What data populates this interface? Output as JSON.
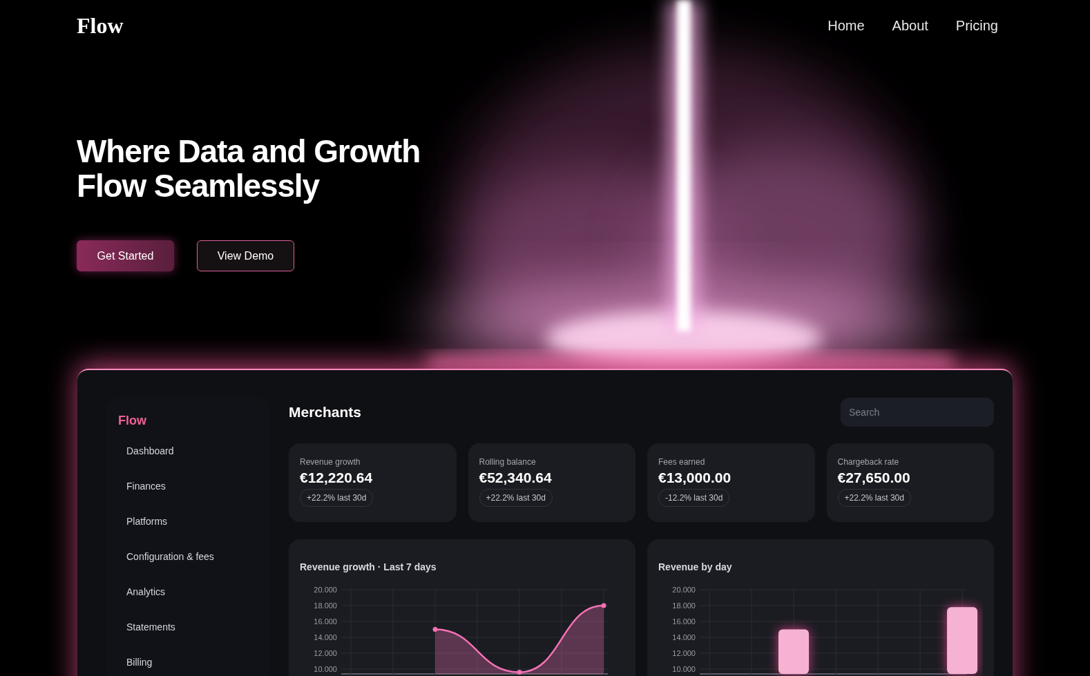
{
  "brand": "Flow",
  "nav": [
    {
      "label": "Home"
    },
    {
      "label": "About"
    },
    {
      "label": "Pricing"
    }
  ],
  "hero": {
    "title": "Where Data and Growth Flow Seamlessly",
    "buttons": [
      {
        "label": "Get Started",
        "kind": "primary"
      },
      {
        "label": "View Demo",
        "kind": "outline"
      }
    ]
  },
  "dashboard": {
    "brand": "Flow",
    "sidebar": {
      "items": [
        {
          "label": "Dashboard",
          "selected": false
        },
        {
          "label": "Finances",
          "selected": false
        },
        {
          "label": "Platforms",
          "selected": false
        },
        {
          "label": "Configuration & fees",
          "selected": false
        },
        {
          "label": "Analytics",
          "selected": false
        },
        {
          "label": "Statements",
          "selected": false
        },
        {
          "label": "Billing",
          "selected": false
        }
      ]
    },
    "title": "Merchants",
    "search": {
      "placeholder": "Search"
    },
    "stats": [
      {
        "label": "Revenue growth",
        "value": "€12,220.64",
        "change": "+22.2% last 30d"
      },
      {
        "label": "Rolling balance",
        "value": "€52,340.64",
        "change": "+22.2% last 30d"
      },
      {
        "label": "Fees earned",
        "value": "€13,000.00",
        "change": "-12.2% last 30d"
      },
      {
        "label": "Chargeback rate",
        "value": "€27,650.00",
        "change": "+22.2% last 30d"
      }
    ],
    "charts": [
      {
        "chart_data": {
          "type": "area",
          "title": "Revenue growth · Last 7 days",
          "grid": true,
          "ylim": [
            9.4,
            20
          ],
          "yticks": [
            {
              "value": 10,
              "label": "10.000"
            },
            {
              "value": 12,
              "label": "12.000"
            },
            {
              "value": 14,
              "label": "14.000"
            },
            {
              "value": 16,
              "label": "16.000"
            },
            {
              "value": 18,
              "label": "18.000"
            },
            {
              "value": 20,
              "label": "20.000"
            }
          ],
          "series": [
            {
              "color": "#f472b6",
              "marker": true,
              "values": [
                null,
                null,
                15,
                null,
                9.6,
                null,
                18
              ]
            }
          ]
        }
      },
      {
        "chart_data": {
          "type": "bar",
          "title": "Revenue by day",
          "grid": true,
          "ylim": [
            9.4,
            20
          ],
          "yticks": [
            {
              "value": 10,
              "label": "10.000"
            },
            {
              "value": 12,
              "label": "12.000"
            },
            {
              "value": 14,
              "label": "14.000"
            },
            {
              "value": 16,
              "label": "16.000"
            },
            {
              "value": 18,
              "label": "18.000"
            },
            {
              "value": 20,
              "label": "20.000"
            }
          ],
          "series": [
            {
              "color": "#f5b3d1",
              "values": [
                null,
                null,
                15,
                null,
                null,
                null,
                17.8
              ]
            }
          ]
        }
      }
    ]
  }
}
